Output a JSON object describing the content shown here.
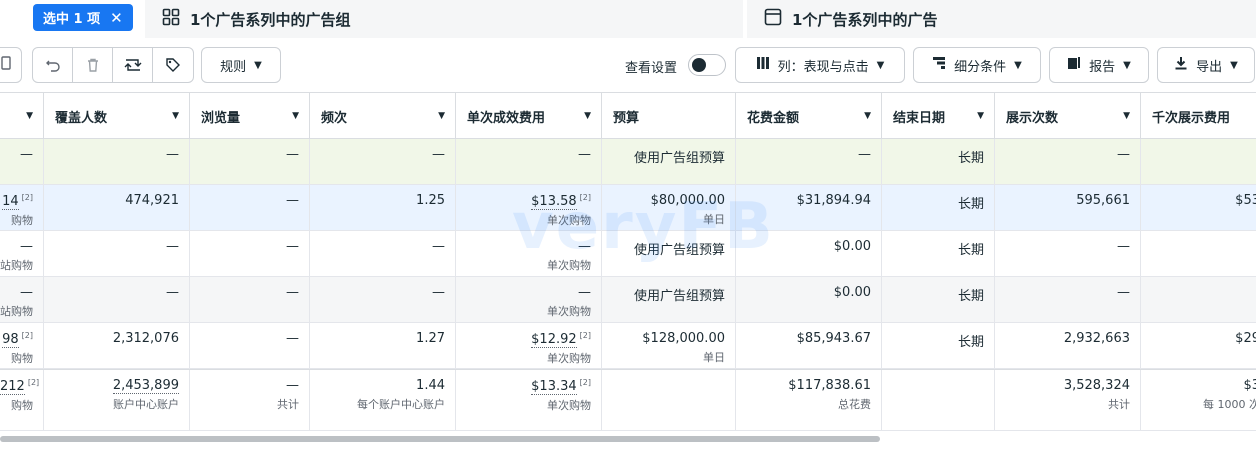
{
  "selection": {
    "label": "选中 1 项",
    "close": "✕"
  },
  "tabs": [
    {
      "label": "1个广告系列中的广告组",
      "icon": "grid-icon"
    },
    {
      "label": "1个广告系列中的广告",
      "icon": "ad-frame-icon"
    }
  ],
  "toolbar": {
    "rules_label": "规则",
    "view_settings_label": "查看设置",
    "columns_label": "列：表现与点击",
    "breakdown_label": "细分条件",
    "reports_label": "报告",
    "export_label": "导出"
  },
  "columns": [
    "覆盖人数",
    "浏览量",
    "频次",
    "单次成效费用",
    "预算",
    "花费金额",
    "结束日期",
    "展示次数",
    "千次展示费用"
  ],
  "rows": [
    {
      "c0": "—",
      "c0s": "",
      "reach": "—",
      "views": "—",
      "freq": "—",
      "cpr": "—",
      "cprs": "",
      "budget": "使用广告组预算",
      "budgets": "",
      "spent": "—",
      "end": "长期",
      "impr": "—",
      "cpm": ""
    },
    {
      "c0": "14",
      "c0s": "购物",
      "reach": "474,921",
      "views": "—",
      "freq": "1.25",
      "cpr": "$13.58",
      "cprs": "单次购物",
      "budget": "$80,000.00",
      "budgets": "单日",
      "spent": "$31,894.94",
      "end": "长期",
      "impr": "595,661",
      "cpm": "$53"
    },
    {
      "c0": "—",
      "c0s": "站购物",
      "reach": "—",
      "views": "—",
      "freq": "—",
      "cpr": "—",
      "cprs": "单次购物",
      "budget": "使用广告组预算",
      "budgets": "",
      "spent": "$0.00",
      "end": "长期",
      "impr": "—",
      "cpm": ""
    },
    {
      "c0": "—",
      "c0s": "站购物",
      "reach": "—",
      "views": "—",
      "freq": "—",
      "cpr": "—",
      "cprs": "单次购物",
      "budget": "使用广告组预算",
      "budgets": "",
      "spent": "$0.00",
      "end": "长期",
      "impr": "—",
      "cpm": ""
    },
    {
      "c0": "98",
      "c0s": "购物",
      "reach": "2,312,076",
      "views": "—",
      "freq": "1.27",
      "cpr": "$12.92",
      "cprs": "单次购物",
      "budget": "$128,000.00",
      "budgets": "单日",
      "spent": "$85,943.67",
      "end": "长期",
      "impr": "2,932,663",
      "cpm": "$29"
    },
    {
      "c0": "212",
      "c0s": "购物",
      "reach": "2,453,899",
      "reachs": "账户中心账户",
      "views": "—",
      "viewss": "共计",
      "freq": "1.44",
      "freqs": "每个账户中心账户",
      "cpr": "$13.34",
      "cprs": "单次购物",
      "budget": "",
      "budgets": "",
      "spent": "$117,838.61",
      "spents": "总花费",
      "end": "",
      "impr": "3,528,324",
      "imprs": "共计",
      "cpm": "$3",
      "cpms": "每 1000 次"
    }
  ],
  "sup_label": "[2]",
  "watermark": "veryFB",
  "colors": {
    "accent": "#1877f2",
    "row_green": "#f1f7e8",
    "row_blue": "#eaf3ff",
    "row_gray": "#f5f6f7"
  }
}
